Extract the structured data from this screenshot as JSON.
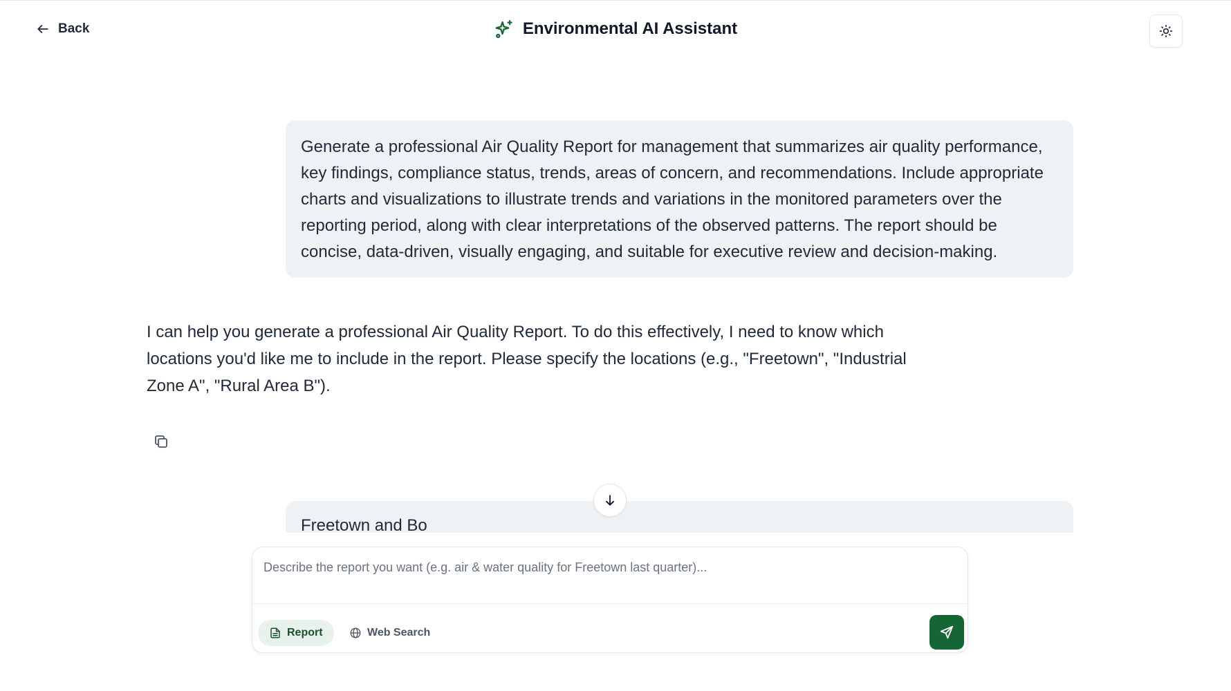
{
  "header": {
    "back_label": "Back",
    "title": "Environmental AI Assistant"
  },
  "messages": {
    "user_1": "Generate a professional Air Quality Report for management that summarizes air quality performance, key findings, compliance status, trends, areas of concern, and recommendations. Include appropriate charts and visualizations to illustrate trends and variations in the monitored parameters over the reporting period, along with clear interpretations of the observed patterns. The report should be concise, data-driven, visually engaging, and suitable for executive review and decision-making.",
    "assistant_1": "I can help you generate a professional Air Quality Report. To do this effectively, I need to know which locations you'd like me to include in the report. Please specify the locations (e.g., \"Freetown\", \"Industrial Zone A\", \"Rural Area B\").",
    "user_2": "Freetown and Bo"
  },
  "composer": {
    "placeholder": "Describe the report you want (e.g. air & water quality for Freetown last quarter)...",
    "report_label": "Report",
    "web_search_label": "Web Search"
  },
  "colors": {
    "brand": "#166534",
    "bubble": "#eff2f5"
  },
  "icons": {
    "back": "arrow-left-icon",
    "logo": "sparkles-icon",
    "theme": "sun-icon",
    "copy": "copy-icon",
    "scroll": "arrow-down-icon",
    "report": "file-text-icon",
    "web": "globe-icon",
    "send": "send-icon"
  }
}
